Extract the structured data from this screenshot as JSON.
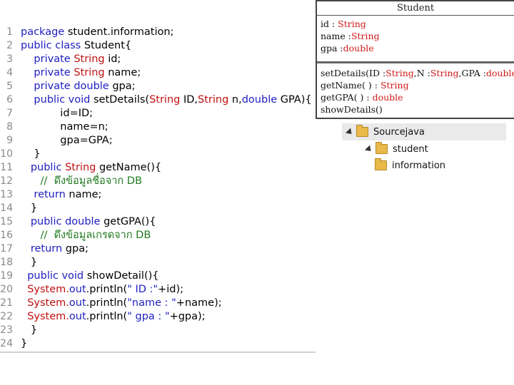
{
  "line_numbers": [
    "1",
    "2",
    "3",
    "4",
    "5",
    "6",
    "7",
    "8",
    "9",
    "10",
    "11",
    "12",
    "13",
    "14",
    "15",
    "16",
    "17",
    "18",
    "19",
    "20",
    "21",
    "22",
    "23",
    "24"
  ],
  "code": [
    [
      {
        "t": "package ",
        "c": "kw"
      },
      {
        "t": "student.information;",
        "c": ""
      }
    ],
    [
      {
        "t": "public class ",
        "c": "kw"
      },
      {
        "t": "Student{",
        "c": ""
      }
    ],
    [
      {
        "t": "    private ",
        "c": "kw"
      },
      {
        "t": "String ",
        "c": "ty"
      },
      {
        "t": "id;",
        "c": ""
      }
    ],
    [
      {
        "t": "    private ",
        "c": "kw"
      },
      {
        "t": "String ",
        "c": "ty"
      },
      {
        "t": "name;",
        "c": ""
      }
    ],
    [
      {
        "t": "    private double ",
        "c": "kw"
      },
      {
        "t": "gpa;",
        "c": ""
      }
    ],
    [
      {
        "t": "    public void ",
        "c": "kw"
      },
      {
        "t": "setDetails(",
        "c": ""
      },
      {
        "t": "String ",
        "c": "ty"
      },
      {
        "t": "ID,",
        "c": ""
      },
      {
        "t": "String ",
        "c": "ty"
      },
      {
        "t": "n,",
        "c": ""
      },
      {
        "t": "double ",
        "c": "kw"
      },
      {
        "t": "GPA){",
        "c": ""
      }
    ],
    [
      {
        "t": "            id=ID;",
        "c": ""
      }
    ],
    [
      {
        "t": "            name=n;",
        "c": ""
      }
    ],
    [
      {
        "t": "            gpa=GPA;",
        "c": ""
      }
    ],
    [
      {
        "t": "    }",
        "c": ""
      }
    ],
    [
      {
        "t": "   public ",
        "c": "kw"
      },
      {
        "t": "String ",
        "c": "ty"
      },
      {
        "t": "getName(){",
        "c": ""
      }
    ],
    [
      {
        "t": "      //  ดึงข้อมูลชื่อจาก DB",
        "c": "cm"
      }
    ],
    [
      {
        "t": "    return ",
        "c": "kw"
      },
      {
        "t": "name;",
        "c": ""
      }
    ],
    [
      {
        "t": "   }",
        "c": ""
      }
    ],
    [
      {
        "t": "   public double ",
        "c": "kw"
      },
      {
        "t": "getGPA(){",
        "c": ""
      }
    ],
    [
      {
        "t": "      //  ดึงข้อมูลเกรดจาก DB",
        "c": "cm"
      }
    ],
    [
      {
        "t": "   return ",
        "c": "kw"
      },
      {
        "t": "gpa;",
        "c": ""
      }
    ],
    [
      {
        "t": "   }",
        "c": ""
      }
    ],
    [
      {
        "t": "  public void ",
        "c": "kw"
      },
      {
        "t": "showDetail(){",
        "c": ""
      }
    ],
    [
      {
        "t": "  System.",
        "c": "ty"
      },
      {
        "t": "out",
        "c": "kw"
      },
      {
        "t": ".println(",
        "c": ""
      },
      {
        "t": "\" ID :\"",
        "c": "st"
      },
      {
        "t": "+id);",
        "c": ""
      }
    ],
    [
      {
        "t": "  System.",
        "c": "ty"
      },
      {
        "t": "out",
        "c": "kw"
      },
      {
        "t": ".println(",
        "c": ""
      },
      {
        "t": "\"name : \"",
        "c": "st"
      },
      {
        "t": "+name);",
        "c": ""
      }
    ],
    [
      {
        "t": "  System.",
        "c": "ty"
      },
      {
        "t": "out",
        "c": "kw"
      },
      {
        "t": ".println(",
        "c": ""
      },
      {
        "t": "\" gpa : \"",
        "c": "st"
      },
      {
        "t": "+gpa);",
        "c": ""
      }
    ],
    [
      {
        "t": "   }",
        "c": ""
      }
    ],
    [
      {
        "t": "}",
        "c": ""
      }
    ]
  ],
  "uml": {
    "class_name": "Student",
    "attributes": [
      [
        {
          "t": "id : ",
          "r": false
        },
        {
          "t": "String",
          "r": true
        }
      ],
      [
        {
          "t": "name :",
          "r": false
        },
        {
          "t": "String",
          "r": true
        }
      ],
      [
        {
          "t": "gpa :",
          "r": false
        },
        {
          "t": "double",
          "r": true
        }
      ]
    ],
    "methods": [
      [
        {
          "t": "setDetails(ID :",
          "r": false
        },
        {
          "t": "String",
          "r": true
        },
        {
          "t": ",N :",
          "r": false
        },
        {
          "t": "String",
          "r": true
        },
        {
          "t": ",GPA :",
          "r": false
        },
        {
          "t": "double",
          "r": true
        },
        {
          "t": ")",
          "r": false
        }
      ],
      [
        {
          "t": "getName( ) : ",
          "r": false
        },
        {
          "t": "String",
          "r": true
        }
      ],
      [
        {
          "t": "getGPA( ) : ",
          "r": false
        },
        {
          "t": "double",
          "r": true
        }
      ],
      [
        {
          "t": "showDetails()",
          "r": false
        }
      ]
    ]
  },
  "tree": {
    "root": "Sourcejava",
    "child": "student",
    "grandchild": "information"
  },
  "colors": {
    "keyword": "#2020c0",
    "type": "#c01010",
    "comment": "#1f7a1f",
    "uml_red": "#d01a1a"
  }
}
